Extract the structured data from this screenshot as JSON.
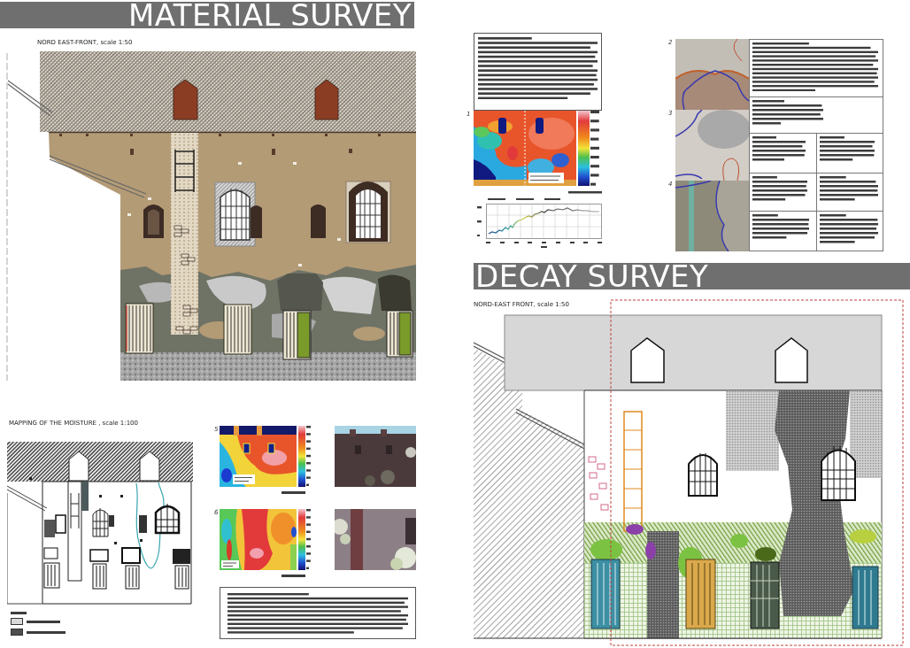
{
  "material_survey": {
    "title": "MATERIAL SURVEY",
    "elevation_caption": "NORD EAST-FRONT, scale 1:50"
  },
  "moisture_mapping": {
    "caption": "MAPPING OF THE MOISTURE , scale 1:100",
    "figures": [
      {
        "number": "5"
      },
      {
        "number": "6"
      }
    ],
    "legend": [
      {
        "color": "#d9d9d9"
      },
      {
        "color": "#4d4d4d"
      }
    ]
  },
  "thermography": {
    "figure_number": "1"
  },
  "wall_samples": {
    "figures": [
      {
        "number": "2"
      },
      {
        "number": "3"
      },
      {
        "number": "4"
      }
    ]
  },
  "decay_survey": {
    "title": "DECAY SURVEY",
    "elevation_caption": "NORD-EAST FRONT, scale 1:50"
  }
}
